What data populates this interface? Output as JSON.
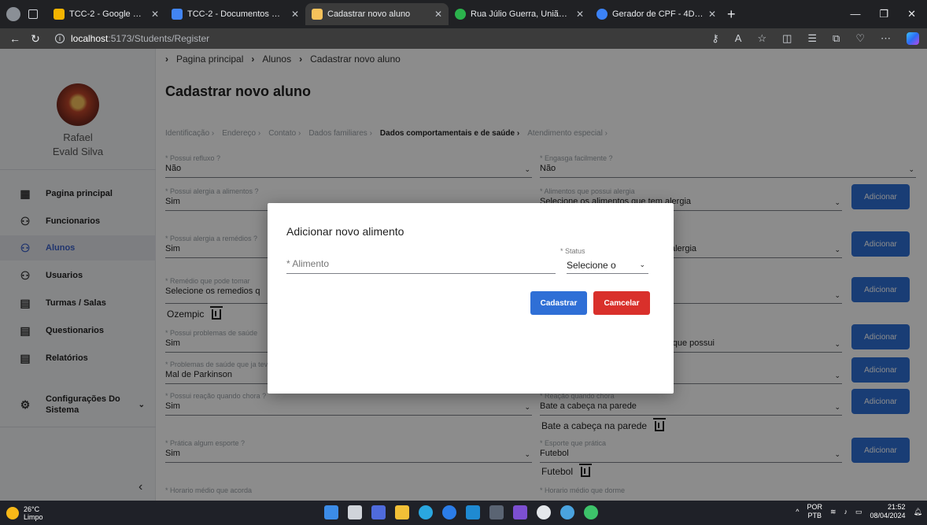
{
  "browser": {
    "tabs": [
      {
        "title": "TCC-2 - Google Drive",
        "color": "#f4b400"
      },
      {
        "title": "TCC-2 - Documentos Google",
        "color": "#4285f4"
      },
      {
        "title": "Cadastrar novo aluno",
        "color": "#f7c25b"
      },
      {
        "title": "Rua Júlio Guerra, União, Ji-Paraná",
        "color": "#2bb24c"
      },
      {
        "title": "Gerador de CPF - 4Devs",
        "color": "#3b82f6"
      }
    ],
    "url_host": "localhost",
    "url_path": ":5173/Students/Register"
  },
  "sidebar": {
    "user_first": "Rafael",
    "user_last": "Evald Silva",
    "items": [
      {
        "label": "Pagina principal",
        "icon": "grid-icon"
      },
      {
        "label": "Funcionarios",
        "icon": "user-icon"
      },
      {
        "label": "Alunos",
        "icon": "user-icon"
      },
      {
        "label": "Usuarios",
        "icon": "user-icon"
      },
      {
        "label": "Turmas / Salas",
        "icon": "document-icon"
      },
      {
        "label": "Questionarios",
        "icon": "document-icon"
      },
      {
        "label": "Relatórios",
        "icon": "document-icon"
      },
      {
        "label": "Configurações Do",
        "label2": "Sistema",
        "icon": "gear-icon"
      }
    ],
    "collapse_glyph": "‹"
  },
  "breadcrumb": [
    "Pagina principal",
    "Alunos",
    "Cadastrar novo aluno"
  ],
  "page_title": "Cadastrar novo aluno",
  "steps": [
    "Identificação",
    "Endereço",
    "Contato",
    "Dados familiares",
    "Dados comportamentais e de saúde",
    "Atendimento especial"
  ],
  "form": {
    "refluxo": {
      "label": "* Possui refluxo ?",
      "value": "Não"
    },
    "engasga": {
      "label": "* Engasga facilmente ?",
      "value": "Não"
    },
    "alergia_alimentos": {
      "label": "* Possui alergia a alimentos ?",
      "value": "Sim"
    },
    "alimentos_alergia": {
      "label": "* Alimentos que possui alergia",
      "value": "Selecione os alimentos que tem alergia"
    },
    "alergia_remedios": {
      "label": "* Possui alergia a remédios ?",
      "value": "Sim"
    },
    "remedios_alergia_value": "alergia",
    "remedio_pode": {
      "label": "* Remédio que pode tomar",
      "value": "Selecione os remedios q"
    },
    "remedio_chip": "Ozempic",
    "problemas_saude": {
      "label": "* Possui problemas de saúde",
      "value": "Sim"
    },
    "problemas_saude_select": "Selecione os problemas de saude que possui",
    "problemas_teve": {
      "label": "* Problemas de saúde que ja teve",
      "value": "Mal de Parkinson"
    },
    "reacao_choro": {
      "label": "* Possui reação quando chora ?",
      "value": "Sim"
    },
    "reacao_quando": {
      "label": "* Reação quando chora",
      "value": "Bate a cabeça na parede"
    },
    "reacao_chip": "Bate a cabeça na parede",
    "esporte": {
      "label": "* Prática algum esporte ?",
      "value": "Sim"
    },
    "esporte_qual": {
      "label": "* Esporte que prática",
      "value": "Futebol"
    },
    "esporte_chip": "Futebol",
    "acorda": {
      "label": "* Horario médio que acorda"
    },
    "dorme": {
      "label": "* Horario médio que dorme"
    },
    "add_label": "Adicionar"
  },
  "modal": {
    "title": "Adicionar novo alimento",
    "food_placeholder": "* Alimento",
    "status_label": "* Status",
    "status_value": "Selecione o",
    "submit": "Cadastrar",
    "cancel": "Camcelar"
  },
  "taskbar": {
    "temp": "26°C",
    "weather": "Limpo",
    "lang1": "POR",
    "lang2": "PTB",
    "time": "21:52",
    "date": "08/04/2024"
  },
  "colors": {
    "primary": "#2f6fd6",
    "danger": "#d9302b",
    "active_nav": "#3a5fc8"
  }
}
